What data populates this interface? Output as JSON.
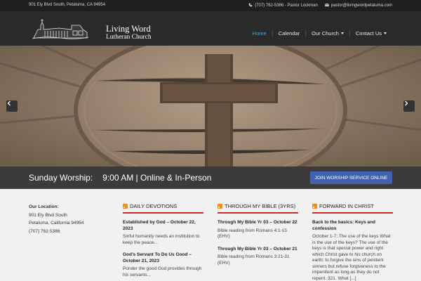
{
  "topbar": {
    "address": "901 Ely Blvd South, Petaluma, CA 94954",
    "phone": "(707) 762-5386 - Pastor Lockman",
    "email": "pastor@livingwordpetaluma.com"
  },
  "logo": {
    "line1": "Living Word",
    "line2": "Lutheran Church"
  },
  "nav": {
    "items": [
      {
        "label": "Home"
      },
      {
        "label": "Calendar"
      },
      {
        "label": "Our Church"
      },
      {
        "label": "Contact Us"
      }
    ]
  },
  "worship": {
    "label": "Sunday Worship:",
    "time": "9:00 AM | Online & In-Person",
    "button": "JOIN WORSHIP SERVICE ONLINE"
  },
  "location": {
    "title": "Our Location:",
    "line1": "901 Ely Blvd South",
    "line2": "Petaluma, California 94954",
    "line3": "(707) 762-5386"
  },
  "columns": [
    {
      "heading": "DAILY DEVOTIONS",
      "posts": [
        {
          "title": "Established by God – October 22, 2023",
          "text": "Sinful humanity needs an institution to keep the peace..."
        },
        {
          "title": "God’s Servant To Do Us Good – October 21, 2023",
          "text": "Ponder the good God provides through his servants..."
        }
      ]
    },
    {
      "heading": "THROUGH MY BIBLE (3YRS)",
      "posts": [
        {
          "title": "Through My Bible Yr 03 – October 22",
          "text": "Bible reading from Romans 4:1-15 (EHV)"
        },
        {
          "title": "Through My Bible Yr 03 – October 21",
          "text": "Bible reading from Romans 3:21-31 (EHV)"
        }
      ]
    },
    {
      "heading": "FORWARD IN CHRIST",
      "posts": [
        {
          "title": "Back to the basics: Keys and confession",
          "text": "October 1-7: The use of the keys What is the use of the keys? The use of the keys is that special power and right which Christ gave to his church on earth: to forgive the sins of penitent sinners but refuse forgiveness to the impenitent as long as they do not repent. 321. What [...]"
        }
      ]
    }
  ]
}
